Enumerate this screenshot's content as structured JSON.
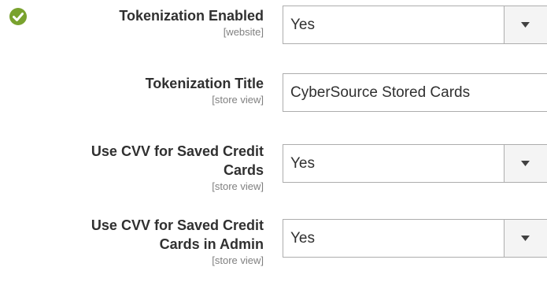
{
  "rows": [
    {
      "label": "Tokenization Enabled",
      "scope": "[website]",
      "value": "Yes",
      "type": "select",
      "has_check_icon": true
    },
    {
      "label": "Tokenization Title",
      "scope": "[store view]",
      "value": "CyberSource Stored Cards",
      "type": "text"
    },
    {
      "label_line1": "Use CVV for Saved Credit",
      "label_line2": "Cards",
      "scope": "[store view]",
      "value": "Yes",
      "type": "select"
    },
    {
      "label_line1": "Use CVV for Saved Credit",
      "label_line2": "Cards in Admin",
      "scope": "[store view]",
      "value": "Yes",
      "type": "select"
    }
  ],
  "colors": {
    "check_green": "#79a22e",
    "label_text": "#303030",
    "scope_text": "#808080",
    "border": "#adadad"
  },
  "icons": {
    "check": "check-circle-icon",
    "dropdown": "triangle-down-icon"
  }
}
